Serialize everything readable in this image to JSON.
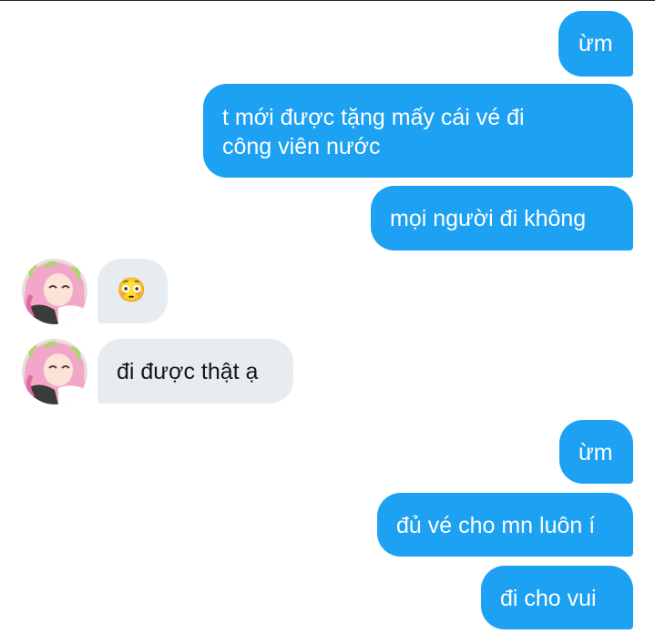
{
  "messages": [
    {
      "sender": "me",
      "text": "ừm"
    },
    {
      "sender": "me",
      "text_line1": "t mới được tặng mấy cái vé đi",
      "text_line2": "công viên nước"
    },
    {
      "sender": "me",
      "text": "mọi người đi không"
    },
    {
      "sender": "other",
      "emoji": "😳",
      "emoji_name": "flushed-face-icon"
    },
    {
      "sender": "other",
      "text": "đi được thật ạ"
    },
    {
      "sender": "me",
      "text": "ừm"
    },
    {
      "sender": "me",
      "text": "đủ vé cho mn luôn í"
    },
    {
      "sender": "me",
      "text": "đi cho vui"
    }
  ],
  "colors": {
    "outgoing_bubble": "#1da1f2",
    "incoming_bubble": "#e6ecf0",
    "outgoing_text": "#ffffff",
    "incoming_text": "#14171a",
    "avatar_hair": "#f2a7c9",
    "avatar_hair_tips": "#a6d86a"
  }
}
